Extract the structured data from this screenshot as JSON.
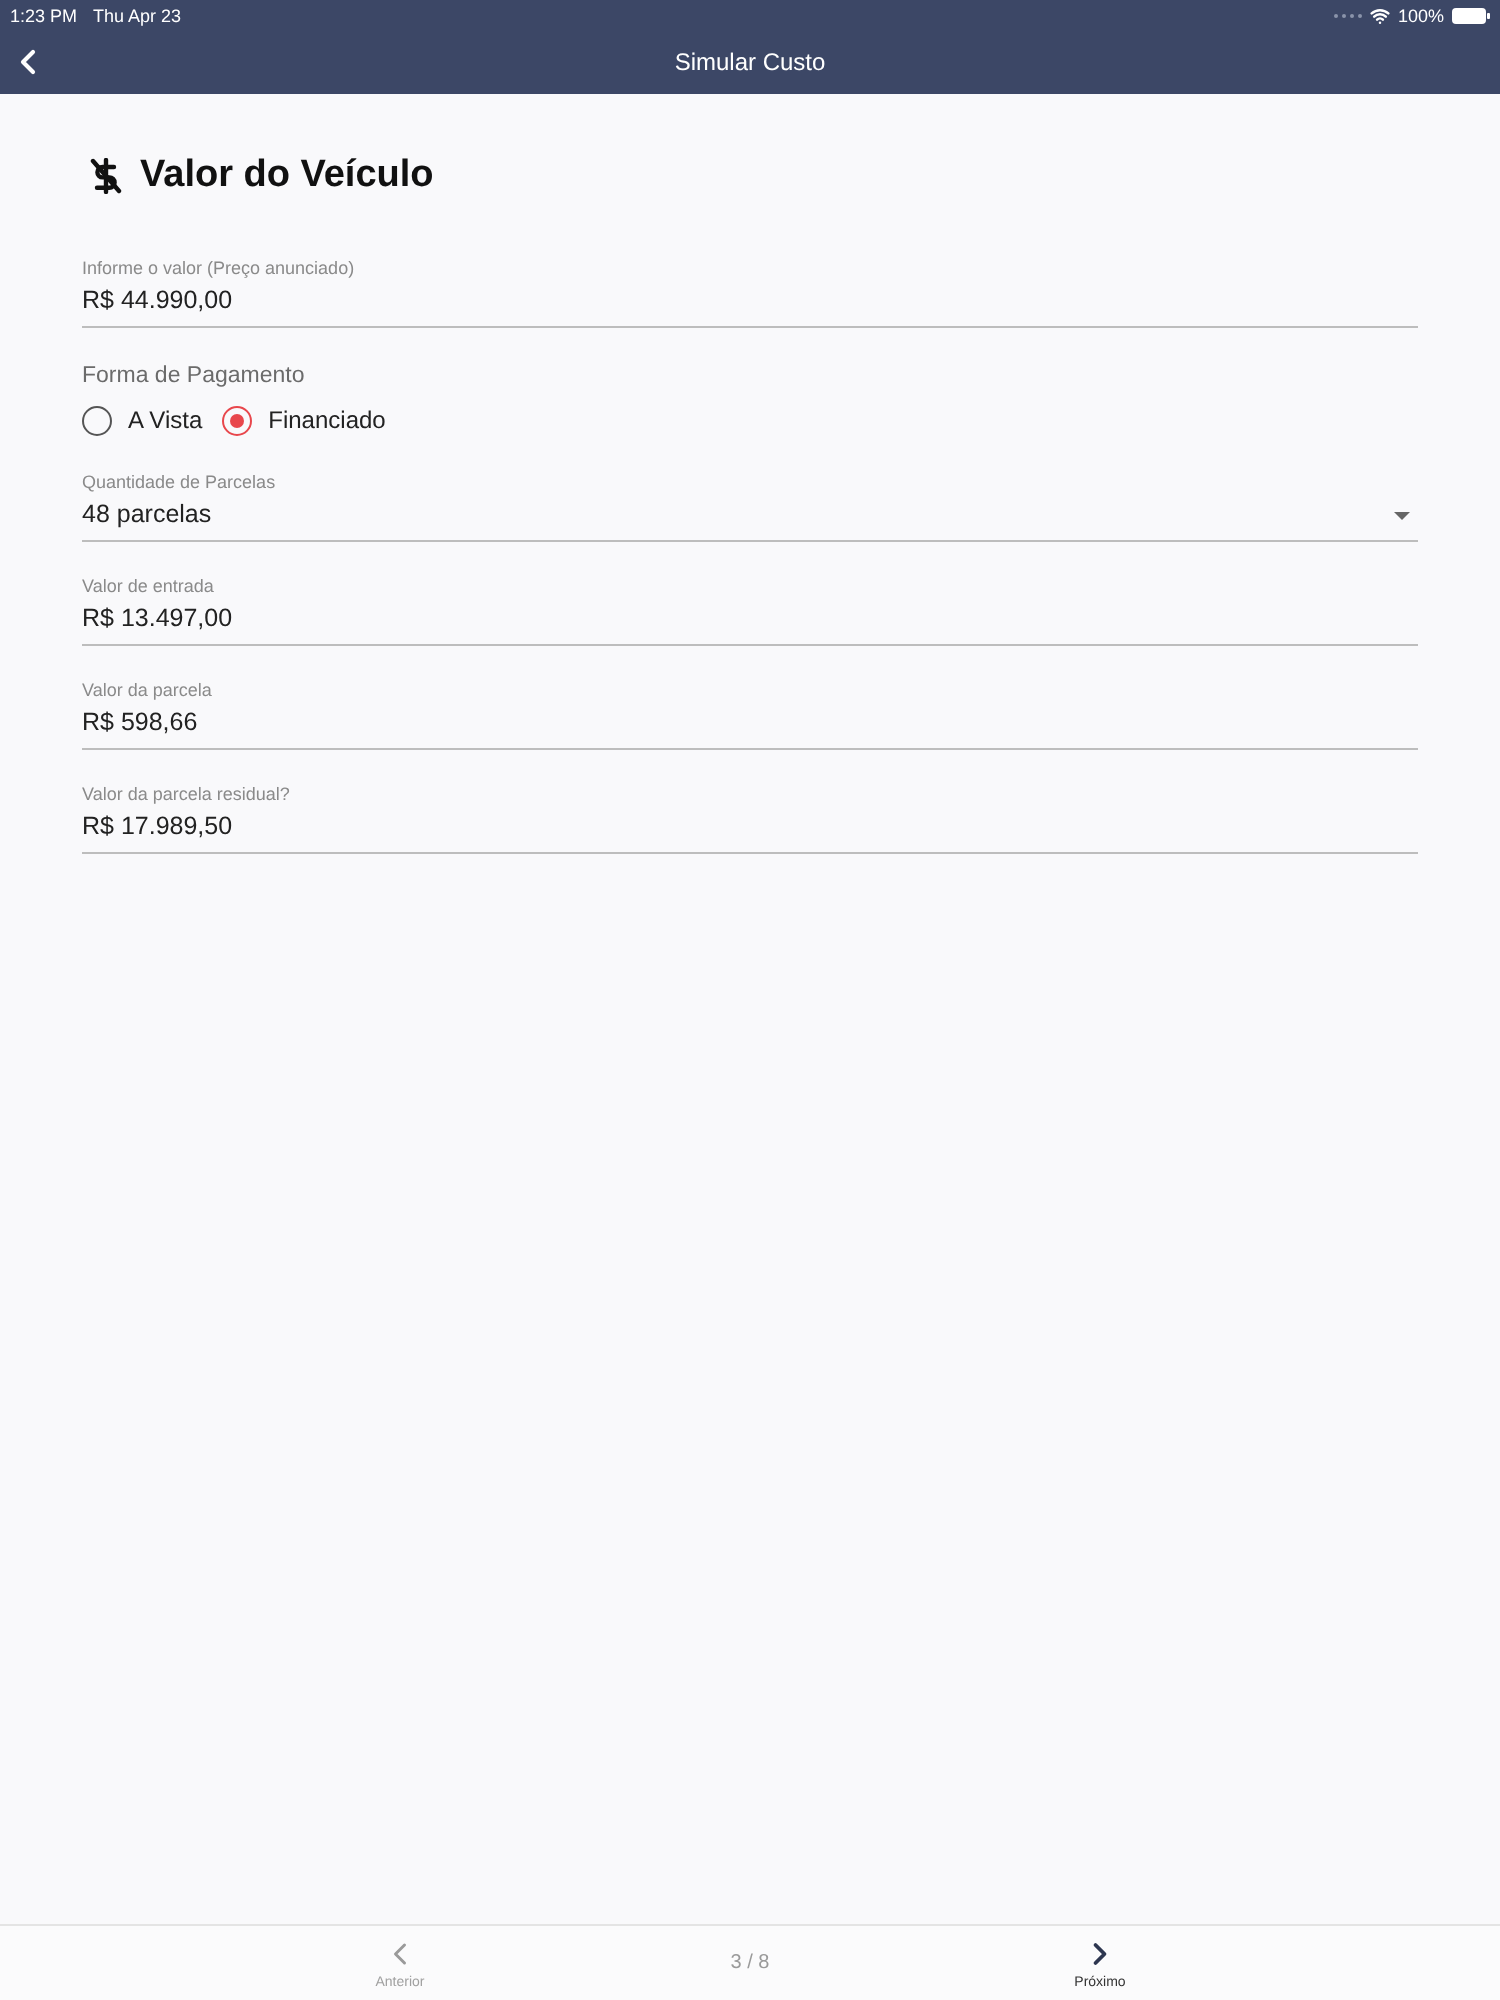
{
  "status_bar": {
    "time": "1:23 PM",
    "date": "Thu Apr 23",
    "battery": "100%"
  },
  "nav_bar": {
    "title": "Simular Custo"
  },
  "section": {
    "title": "Valor do Veículo"
  },
  "fields": [
    {
      "kind": "text",
      "label": "Informe o valor (Preço anunciado)",
      "value": "R$ 44.990,00"
    },
    {
      "kind": "radio",
      "label": "Forma de Pagamento",
      "options": [
        {
          "label": "A Vista",
          "selected": false
        },
        {
          "label": "Financiado",
          "selected": true
        }
      ]
    },
    {
      "kind": "select",
      "label": "Quantidade de Parcelas",
      "value": "48 parcelas"
    },
    {
      "kind": "text",
      "label": "Valor de entrada",
      "value": "R$ 13.497,00"
    },
    {
      "kind": "text",
      "label": "Valor da parcela",
      "value": "R$ 598,66"
    },
    {
      "kind": "text",
      "label": "Valor da parcela residual?",
      "value": "R$ 17.989,50"
    }
  ],
  "footer": {
    "previous": {
      "label": "Anterior",
      "disabled": true
    },
    "page": "3 / 8",
    "next": {
      "label": "Próximo",
      "disabled": false
    }
  }
}
